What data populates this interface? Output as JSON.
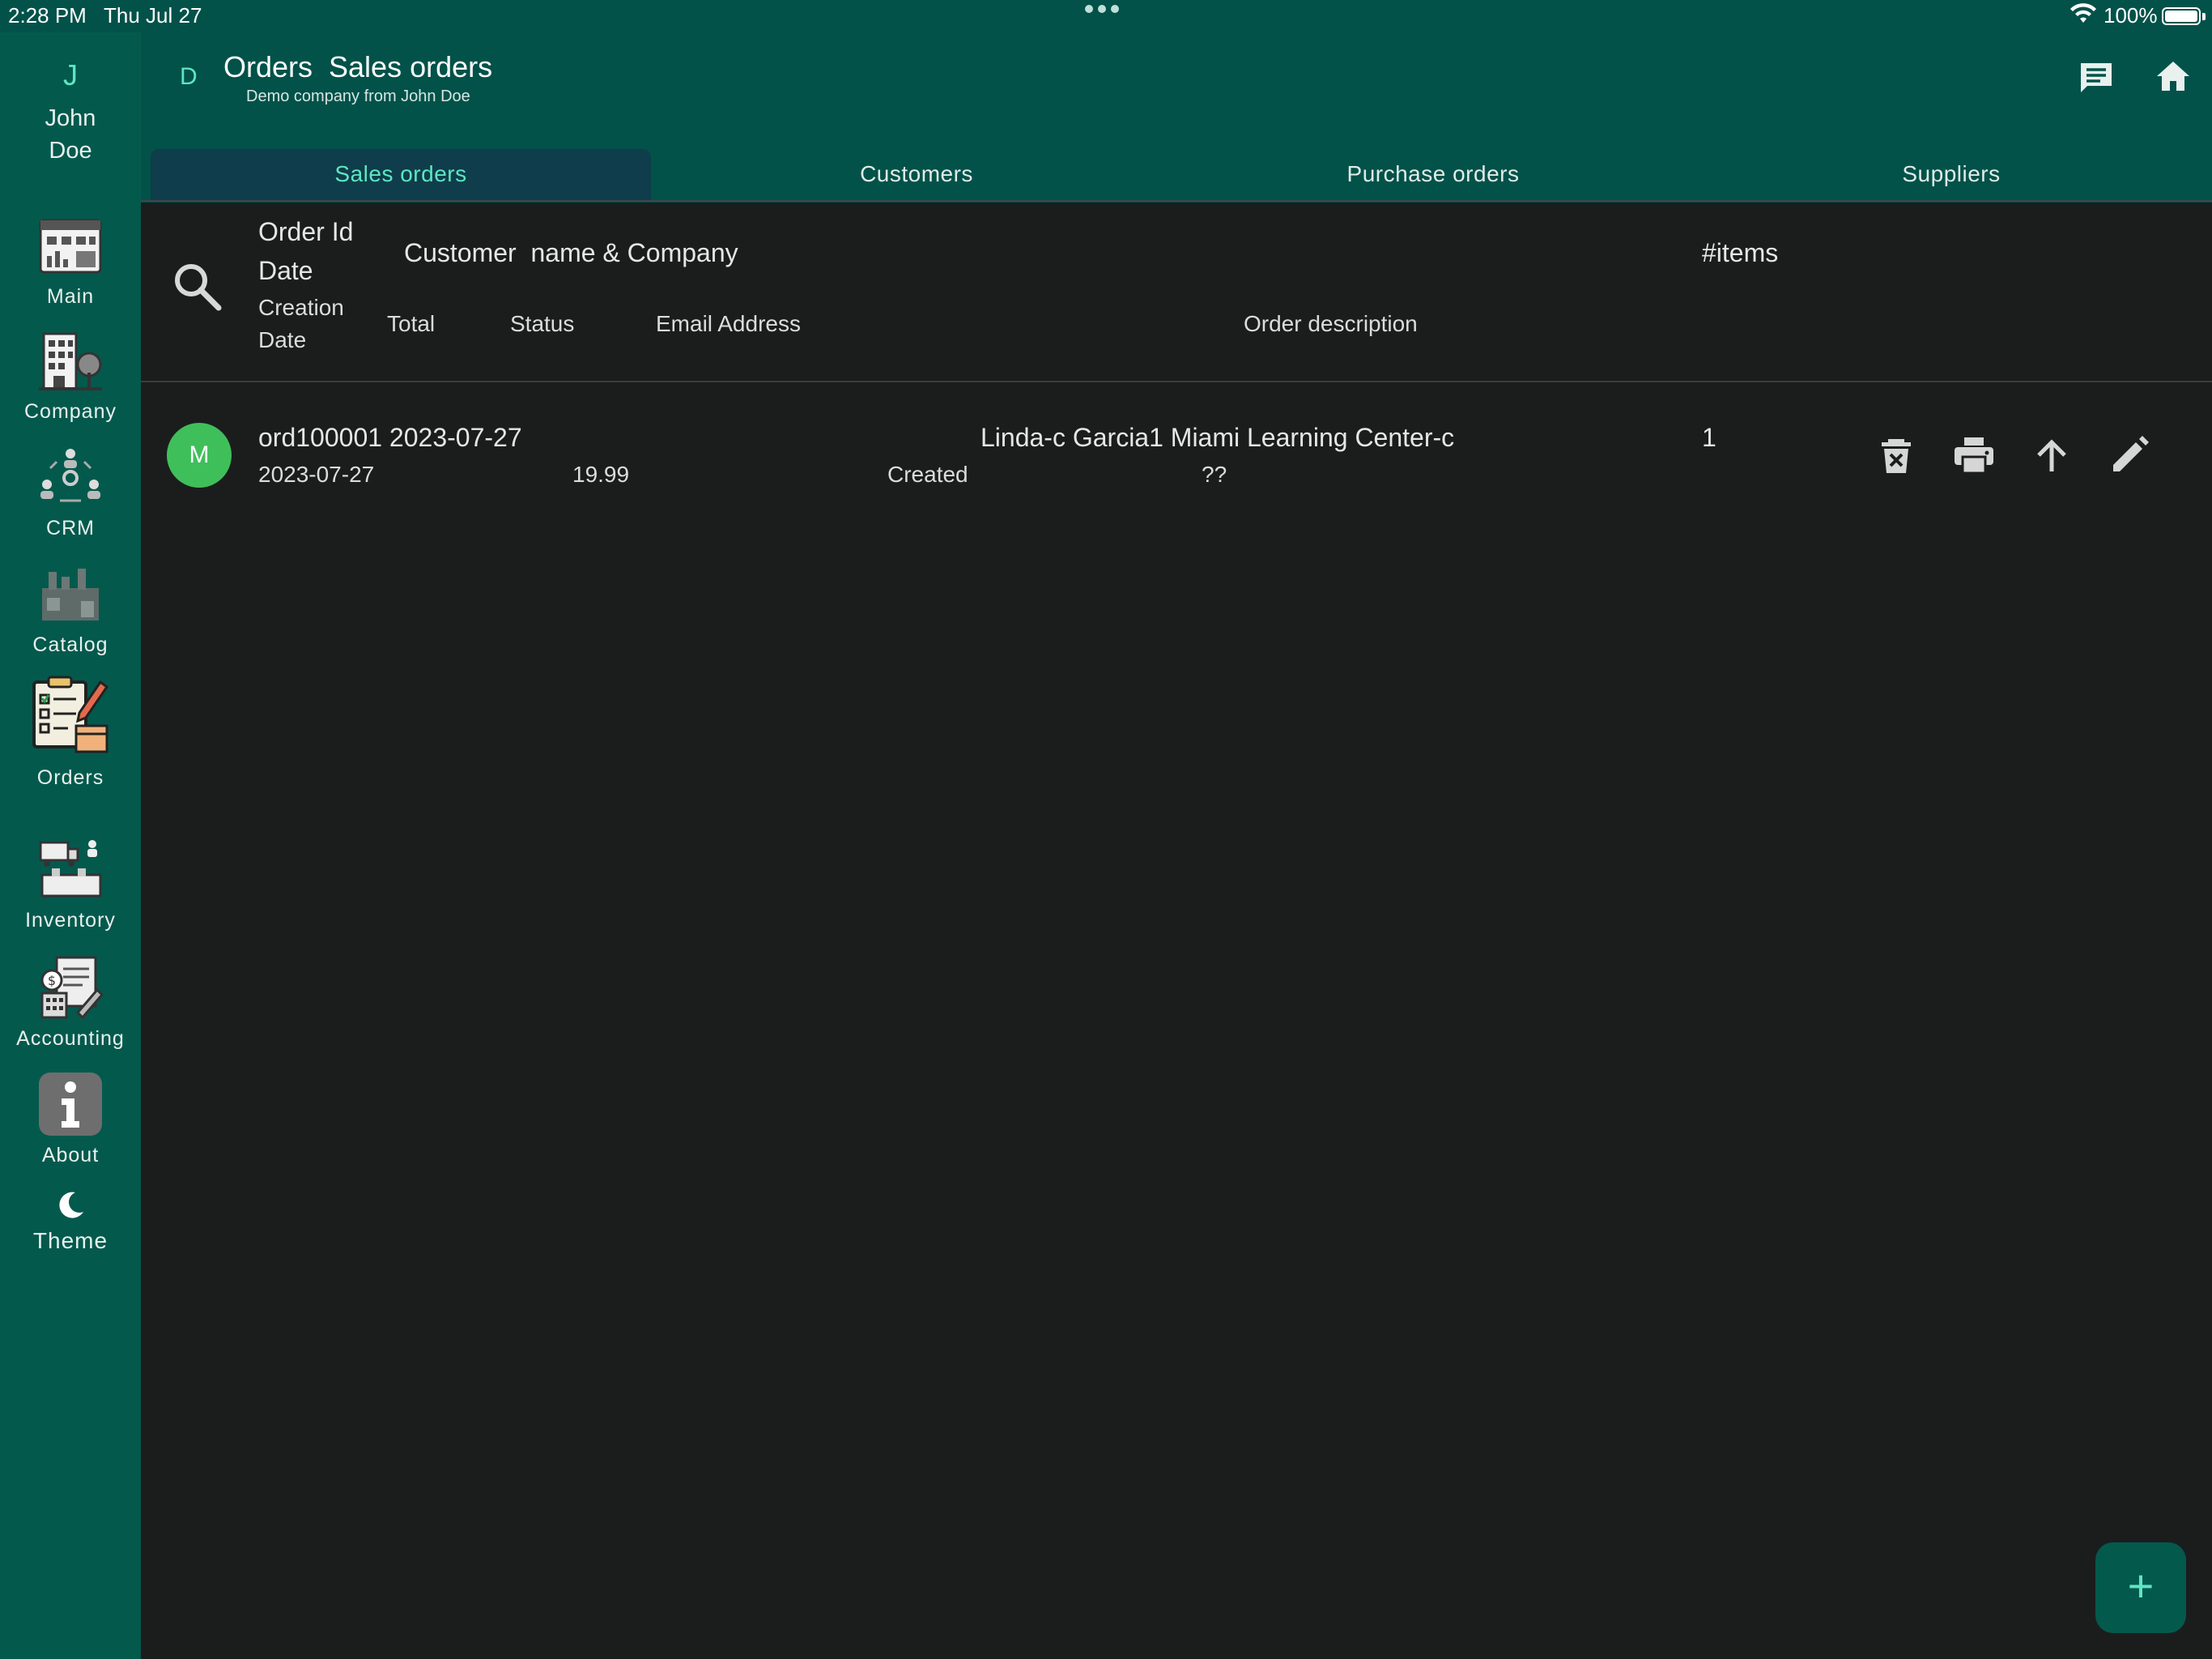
{
  "status_bar": {
    "time": "2:28 PM",
    "date": "Thu Jul 27",
    "battery": "100%"
  },
  "user": {
    "initial": "J",
    "name_line1": "John",
    "name_line2": "Doe"
  },
  "nav": [
    {
      "label": "Main",
      "icon": "dashboard-icon"
    },
    {
      "label": "Company",
      "icon": "company-building-icon"
    },
    {
      "label": "CRM",
      "icon": "crm-people-icon"
    },
    {
      "label": "Catalog",
      "icon": "catalog-factory-icon"
    },
    {
      "label": "Orders",
      "icon": "orders-clipboard-icon"
    },
    {
      "label": "Inventory",
      "icon": "inventory-warehouse-icon"
    },
    {
      "label": "Accounting",
      "icon": "accounting-calculator-icon"
    },
    {
      "label": "About",
      "icon": "info-icon"
    },
    {
      "label": "Theme",
      "icon": "moon-icon"
    }
  ],
  "header": {
    "company_initial": "D",
    "title": "Orders  Sales orders",
    "subtitle": "Demo company from John Doe"
  },
  "tabs": [
    {
      "label": "Sales orders",
      "active": true
    },
    {
      "label": "Customers",
      "active": false
    },
    {
      "label": "Purchase orders",
      "active": false
    },
    {
      "label": "Suppliers",
      "active": false
    }
  ],
  "columns": {
    "order_id": "Order Id",
    "date": "Date",
    "customer": "Customer  name & Company",
    "items": "#items",
    "creation_date_1": "Creation",
    "creation_date_2": "Date",
    "total": "Total",
    "status": "Status",
    "email": "Email Address",
    "description": "Order description"
  },
  "rows": [
    {
      "avatar": "M",
      "order_line": "ord100001 2023-07-27",
      "customer": "Linda-c Garcia1 Miami Learning Center-c",
      "items": "1",
      "creation_date": "2023-07-27",
      "total": "19.99",
      "status": "Created",
      "description": "??"
    }
  ],
  "fab": {
    "label": "+"
  },
  "colors": {
    "rail": "#04594d",
    "header": "#02524a",
    "accent": "#5ee6c2",
    "background": "#1b1d1d",
    "avatar": "#3fbf5a"
  }
}
